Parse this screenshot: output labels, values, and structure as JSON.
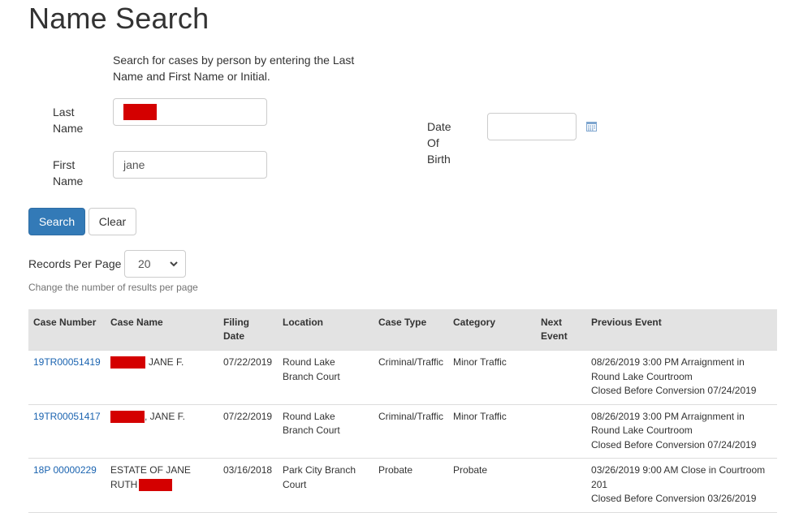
{
  "page": {
    "title": "Name Search",
    "intro": "Search for cases by person by entering the Last Name and First Name or Initial."
  },
  "form": {
    "last_name": {
      "label": "Last Name",
      "value": "[redacted]"
    },
    "first_name": {
      "label": "First Name",
      "value": "jane"
    },
    "dob": {
      "label": "Date Of Birth",
      "value": "",
      "icon": "calendar-icon"
    },
    "search_label": "Search",
    "clear_label": "Clear"
  },
  "records_per_page": {
    "label": "Records Per Page",
    "value": "20",
    "help": "Change the number of results per page"
  },
  "colors": {
    "primary": "#337ab7",
    "link": "#1a63b0",
    "header_bg": "#e3e3e3",
    "redaction": "#d40000"
  },
  "table": {
    "headers": [
      "Case Number",
      "Case Name",
      "Filing Date",
      "Location",
      "Case Type",
      "Category",
      "Next Event",
      "Previous Event"
    ],
    "rows": [
      {
        "case_number": "19TR00051419",
        "case_name_suffix": "JANE F.",
        "filing_date": "07/22/2019",
        "location": "Round Lake Branch Court",
        "case_type": "Criminal/Traffic",
        "category": "Minor Traffic",
        "next_event": "",
        "previous_event": [
          "08/26/2019 3:00 PM Arraignment in Round Lake Courtroom",
          "Closed Before Conversion 07/24/2019"
        ]
      },
      {
        "case_number": "19TR00051417",
        "case_name_suffix": ", JANE F.",
        "filing_date": "07/22/2019",
        "location": "Round Lake Branch Court",
        "case_type": "Criminal/Traffic",
        "category": "Minor Traffic",
        "next_event": "",
        "previous_event": [
          "08/26/2019 3:00 PM Arraignment in Round Lake Courtroom",
          "Closed Before Conversion 07/24/2019"
        ]
      },
      {
        "case_number": "18P 00000229",
        "case_name_prefix": "ESTATE OF JANE RUTH",
        "filing_date": "03/16/2018",
        "location": "Park City Branch Court",
        "case_type": "Probate",
        "category": "Probate",
        "next_event": "",
        "previous_event": [
          "03/26/2019 9:00 AM Close in Courtroom 201",
          "Closed Before Conversion 03/26/2019"
        ]
      }
    ]
  }
}
